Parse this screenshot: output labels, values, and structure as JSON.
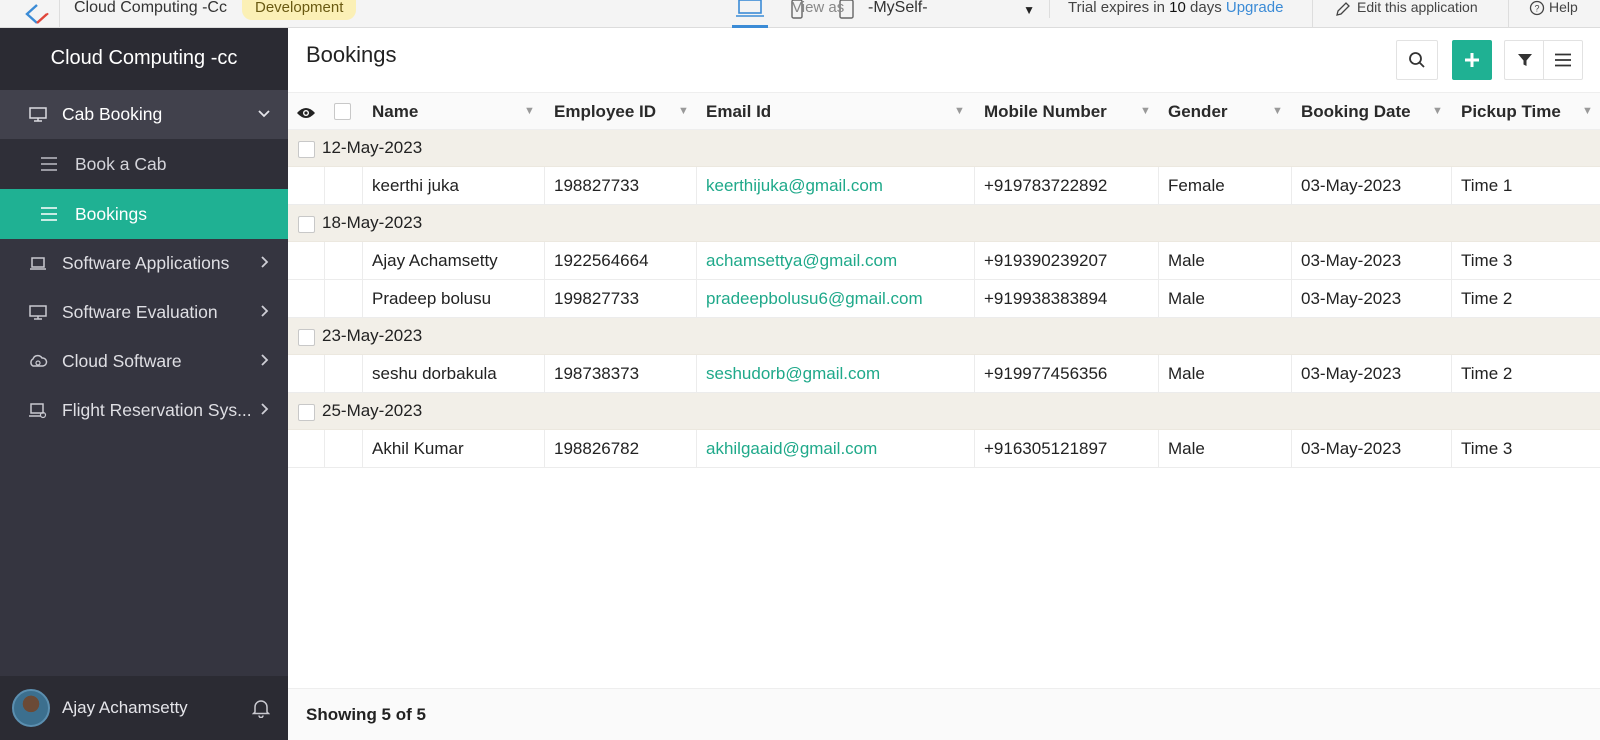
{
  "topbar": {
    "app_name": "Cloud Computing -Cc",
    "environment": "Development",
    "view_as_label": "View as",
    "view_as_value": "-MySelf-",
    "trial_prefix": "Trial expires in",
    "trial_days": "10",
    "trial_suffix": "days",
    "upgrade_label": "Upgrade",
    "edit_label": "Edit this application",
    "help_label": "Help"
  },
  "sidebar": {
    "app_title": "Cloud Computing -cc",
    "items": [
      {
        "label": "Cab Booking",
        "icon": "monitor-icon",
        "expanded": true
      },
      {
        "label": "Software Applications",
        "icon": "laptop-icon"
      },
      {
        "label": "Software Evaluation",
        "icon": "monitor-icon"
      },
      {
        "label": "Cloud Software",
        "icon": "cloud-gear-icon"
      },
      {
        "label": "Flight Reservation Sys...",
        "icon": "laptop-gear-icon"
      }
    ],
    "sub_items": [
      {
        "label": "Book a Cab",
        "icon": "list-icon"
      },
      {
        "label": "Bookings",
        "icon": "list-icon",
        "active": true
      }
    ],
    "user_name": "Ajay Achamsetty"
  },
  "main": {
    "title": "Bookings",
    "columns": [
      "Name",
      "Employee ID",
      "Email Id",
      "Mobile Number",
      "Gender",
      "Booking Date",
      "Pickup Time"
    ],
    "groups": [
      {
        "label": "12-May-2023",
        "rows": [
          {
            "name": "keerthi juka",
            "employee_id": "198827733",
            "email": "keerthijuka@gmail.com",
            "mobile": "+919783722892",
            "gender": "Female",
            "booking_date": "03-May-2023",
            "pickup_time": "Time 1"
          }
        ]
      },
      {
        "label": "18-May-2023",
        "rows": [
          {
            "name": "Ajay Achamsetty",
            "employee_id": "1922564664",
            "email": "achamsettya@gmail.com",
            "mobile": "+919390239207",
            "gender": "Male",
            "booking_date": "03-May-2023",
            "pickup_time": "Time 3"
          },
          {
            "name": "Pradeep bolusu",
            "employee_id": "199827733",
            "email": "pradeepbolusu6@gmail.com",
            "mobile": "+919938383894",
            "gender": "Male",
            "booking_date": "03-May-2023",
            "pickup_time": "Time 2"
          }
        ]
      },
      {
        "label": "23-May-2023",
        "rows": [
          {
            "name": "seshu dorbakula",
            "employee_id": "198738373",
            "email": "seshudorb@gmail.com",
            "mobile": "+919977456356",
            "gender": "Male",
            "booking_date": "03-May-2023",
            "pickup_time": "Time 2"
          }
        ]
      },
      {
        "label": "25-May-2023",
        "rows": [
          {
            "name": "Akhil Kumar",
            "employee_id": "198826782",
            "email": "akhilgaaid@gmail.com",
            "mobile": "+916305121897",
            "gender": "Male",
            "booking_date": "03-May-2023",
            "pickup_time": "Time 3"
          }
        ]
      }
    ],
    "status_text": "Showing 5 of 5"
  },
  "colors": {
    "accent": "#1fb193",
    "sidebar_bg": "#353540",
    "group_row_bg": "#f2efe8",
    "link": "#1fa98a",
    "upgrade_link": "#3b8bd6",
    "badge_bg": "#fbf0b6"
  }
}
